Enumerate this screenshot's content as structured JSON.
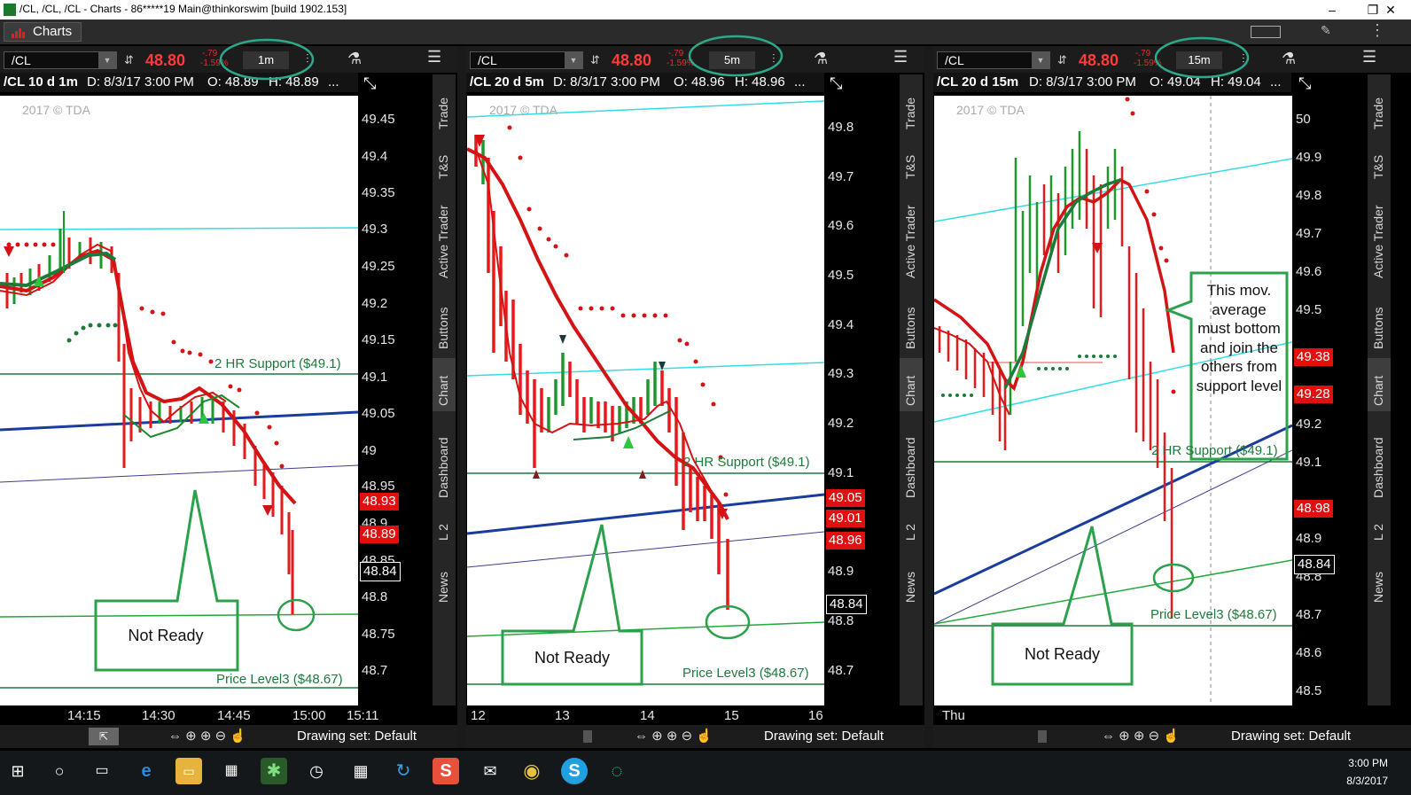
{
  "window": {
    "title": "/CL, /CL, /CL - Charts - 86*****19 Main@thinkorswim [build 1902.153]",
    "buttons": [
      "–",
      "❐",
      "✕"
    ]
  },
  "menu": {
    "charts_tab": "Charts"
  },
  "side_tabs": [
    "Trade",
    "T&S",
    "Active Trader",
    "Buttons",
    "Chart",
    "Dashboard",
    "L 2",
    "News"
  ],
  "panes": [
    {
      "symbol": "/CL",
      "last": "48.80",
      "change": "-.79",
      "change_pct": "-1.59%",
      "timeframe": "1m",
      "status": {
        "title": "/CL 10 d 1m",
        "date": "D: 8/3/17 3:00 PM",
        "open": "O: 48.89",
        "high": "H: 48.89",
        "more": "..."
      },
      "watermark": "2017 © TDA",
      "y_ticks": [
        "49.45",
        "49.4",
        "49.35",
        "49.3",
        "49.25",
        "49.2",
        "49.15",
        "49.1",
        "49.05",
        "49",
        "48.95",
        "48.9",
        "48.85",
        "48.8",
        "48.75",
        "48.7"
      ],
      "price_tags": [
        {
          "text": "48.93",
          "color": "#e01010"
        },
        {
          "text": "48.89",
          "color": "#e01010"
        },
        {
          "text": "48.84",
          "color": "#000000"
        }
      ],
      "x_labels": [
        "14:15",
        "14:30",
        "14:45",
        "15:00",
        "15:11"
      ],
      "annotations": {
        "support": "2 HR Support ($49.1)",
        "price_level": "Price Level3 ($48.67)",
        "callout": "Not Ready"
      },
      "drawing_set": "Drawing set: Default"
    },
    {
      "symbol": "/CL",
      "last": "48.80",
      "change": "-.79",
      "change_pct": "-1.59%",
      "timeframe": "5m",
      "status": {
        "title": "/CL 20 d 5m",
        "date": "D: 8/3/17 3:00 PM",
        "open": "O: 48.96",
        "high": "H: 48.96",
        "more": "..."
      },
      "watermark": "2017 © TDA",
      "y_ticks": [
        "49.8",
        "49.7",
        "49.6",
        "49.5",
        "49.4",
        "49.3",
        "49.2",
        "49.1",
        "49",
        "48.9",
        "48.8",
        "48.7"
      ],
      "price_tags": [
        {
          "text": "49.05",
          "color": "#e01010"
        },
        {
          "text": "49.01",
          "color": "#e01010"
        },
        {
          "text": "48.96",
          "color": "#e01010"
        },
        {
          "text": "48.84",
          "color": "#000000"
        }
      ],
      "x_labels": [
        "12",
        "13",
        "14",
        "15",
        "16"
      ],
      "annotations": {
        "support": "2 HR Support ($49.1)",
        "price_level": "Price Level3 ($48.67)",
        "callout": "Not Ready"
      },
      "drawing_set": "Drawing set: Default"
    },
    {
      "symbol": "/CL",
      "last": "48.80",
      "change": "-.79",
      "change_pct": "-1.59%",
      "timeframe": "15m",
      "status": {
        "title": "/CL 20 d 15m",
        "date": "D: 8/3/17 3:00 PM",
        "open": "O: 49.04",
        "high": "H: 49.04",
        "more": "..."
      },
      "watermark": "2017 © TDA",
      "y_ticks": [
        "50",
        "49.9",
        "49.8",
        "49.7",
        "49.6",
        "49.5",
        "49.2",
        "49.1",
        "48.9",
        "48.8",
        "48.7",
        "48.6",
        "48.5"
      ],
      "price_tags": [
        {
          "text": "49.38",
          "color": "#e01010"
        },
        {
          "text": "49.28",
          "color": "#e01010"
        },
        {
          "text": "48.98",
          "color": "#e01010"
        },
        {
          "text": "48.84",
          "color": "#000000"
        }
      ],
      "x_labels": [
        "Thu"
      ],
      "annotations": {
        "support": "2 HR Support ($49.1)",
        "price_level": "Price Level3 ($48.67)",
        "callout": "Not Ready",
        "note": "This mov. average must bottom and join the others from support level"
      },
      "drawing_set": "Drawing set: Default"
    }
  ],
  "taskbar": {
    "time": "3:00 PM",
    "date": "8/3/2017"
  }
}
